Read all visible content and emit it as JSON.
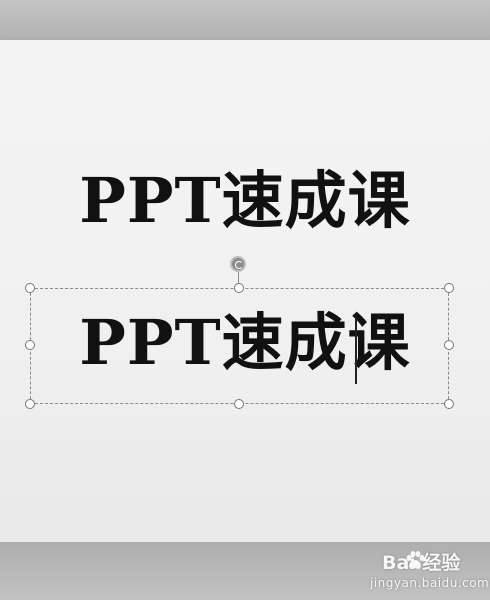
{
  "slide": {
    "title_text": "PPT速成课",
    "selected_text": "PPT速成课"
  },
  "icons": [
    "rotate-icon",
    "resize-handle",
    "text-caret",
    "baidu-paw-icon"
  ],
  "colors": {
    "text": "#111111",
    "slide_background": "#f2f2f2",
    "selection_border": "#8a8a8a"
  },
  "watermark": {
    "logo_text": "Bai 经验",
    "url": "jingyan.baidu.com"
  }
}
